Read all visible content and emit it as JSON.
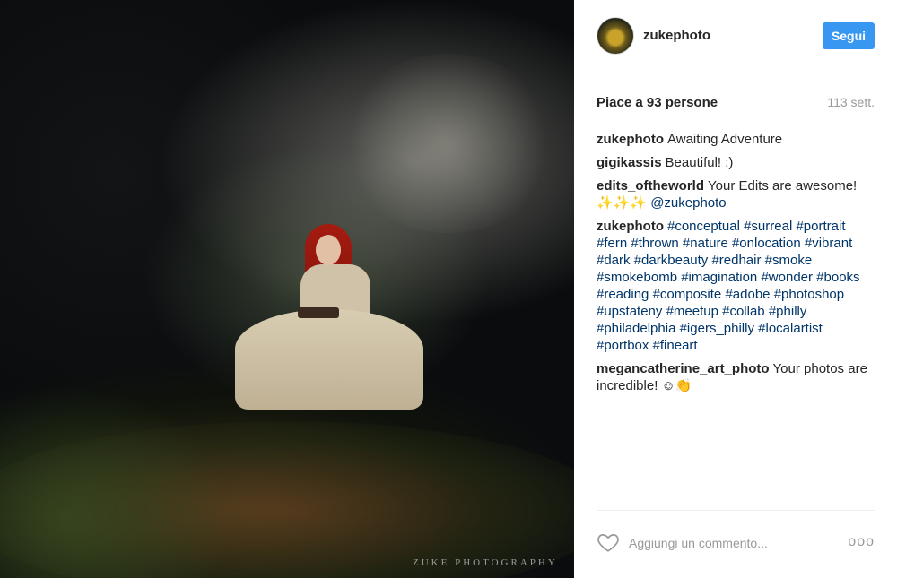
{
  "post": {
    "username": "zukephoto",
    "follow_label": "Segui",
    "likes_text": "Piace a 93 persone",
    "time_ago": "113 sett.",
    "watermark": "ZUKE PHOTOGRAPHY",
    "photo_alt": "Woman in white dress sitting in forest"
  },
  "comments": [
    {
      "user": "zukephoto",
      "parts": [
        {
          "text": "Awaiting Adventure",
          "tag": false
        }
      ]
    },
    {
      "user": "gigikassis",
      "parts": [
        {
          "text": "Beautiful! :)",
          "tag": false
        }
      ]
    },
    {
      "user": "edits_oftheworld",
      "parts": [
        {
          "text": "Your Edits are awesome! ✨✨✨ ",
          "tag": false
        },
        {
          "text": "@zukephoto",
          "tag": true
        }
      ]
    },
    {
      "user": "zukephoto",
      "parts": [
        {
          "text": "#conceptual",
          "tag": true
        },
        {
          "text": " ",
          "tag": false
        },
        {
          "text": "#surreal",
          "tag": true
        },
        {
          "text": " ",
          "tag": false
        },
        {
          "text": "#portrait",
          "tag": true
        },
        {
          "text": " ",
          "tag": false
        },
        {
          "text": "#fern",
          "tag": true
        },
        {
          "text": " ",
          "tag": false
        },
        {
          "text": "#thrown",
          "tag": true
        },
        {
          "text": " ",
          "tag": false
        },
        {
          "text": "#nature",
          "tag": true
        },
        {
          "text": " ",
          "tag": false
        },
        {
          "text": "#onlocation",
          "tag": true
        },
        {
          "text": " ",
          "tag": false
        },
        {
          "text": "#vibrant",
          "tag": true
        },
        {
          "text": " ",
          "tag": false
        },
        {
          "text": "#dark",
          "tag": true
        },
        {
          "text": " ",
          "tag": false
        },
        {
          "text": "#darkbeauty",
          "tag": true
        },
        {
          "text": " ",
          "tag": false
        },
        {
          "text": "#redhair",
          "tag": true
        },
        {
          "text": " ",
          "tag": false
        },
        {
          "text": "#smoke",
          "tag": true
        },
        {
          "text": " ",
          "tag": false
        },
        {
          "text": "#smokebomb",
          "tag": true
        },
        {
          "text": " ",
          "tag": false
        },
        {
          "text": "#imagination",
          "tag": true
        },
        {
          "text": " ",
          "tag": false
        },
        {
          "text": "#wonder",
          "tag": true
        },
        {
          "text": " ",
          "tag": false
        },
        {
          "text": "#books",
          "tag": true
        },
        {
          "text": " ",
          "tag": false
        },
        {
          "text": "#reading",
          "tag": true
        },
        {
          "text": " ",
          "tag": false
        },
        {
          "text": "#composite",
          "tag": true
        },
        {
          "text": " ",
          "tag": false
        },
        {
          "text": "#adobe",
          "tag": true
        },
        {
          "text": " ",
          "tag": false
        },
        {
          "text": "#photoshop",
          "tag": true
        },
        {
          "text": " ",
          "tag": false
        },
        {
          "text": "#upstateny",
          "tag": true
        },
        {
          "text": " ",
          "tag": false
        },
        {
          "text": "#meetup",
          "tag": true
        },
        {
          "text": " ",
          "tag": false
        },
        {
          "text": "#collab",
          "tag": true
        },
        {
          "text": " ",
          "tag": false
        },
        {
          "text": "#philly",
          "tag": true
        },
        {
          "text": " ",
          "tag": false
        },
        {
          "text": "#philadelphia",
          "tag": true
        },
        {
          "text": " ",
          "tag": false
        },
        {
          "text": "#igers_philly",
          "tag": true
        },
        {
          "text": " ",
          "tag": false
        },
        {
          "text": "#localartist",
          "tag": true
        },
        {
          "text": " ",
          "tag": false
        },
        {
          "text": "#portbox",
          "tag": true
        },
        {
          "text": " ",
          "tag": false
        },
        {
          "text": "#fineart",
          "tag": true
        }
      ]
    },
    {
      "user": "megancatherine_art_photo",
      "parts": [
        {
          "text": "Your photos are incredible! ☺👏",
          "tag": false
        }
      ]
    }
  ],
  "footer": {
    "comment_placeholder": "Aggiungi un commento...",
    "more_label": "ooo"
  },
  "colors": {
    "follow_bg": "#3897f0",
    "hashtag": "#003569",
    "muted": "#999999"
  },
  "icons": {
    "like": "heart-icon",
    "more": "more-options-icon"
  }
}
